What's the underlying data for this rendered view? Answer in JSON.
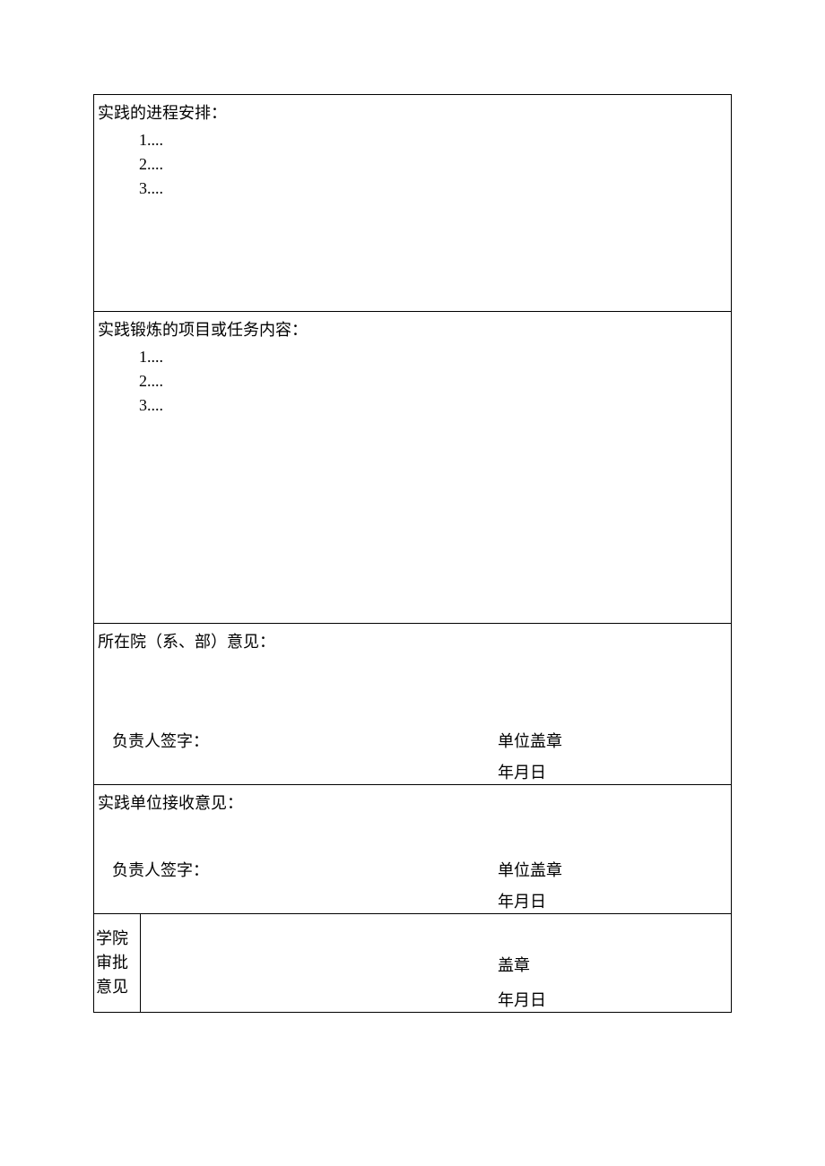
{
  "section1": {
    "title": "实践的进程安排：",
    "items": [
      "1....",
      "2....",
      "3...."
    ]
  },
  "section2": {
    "title": "实践锻炼的项目或任务内容：",
    "items": [
      "1....",
      "2....",
      "3...."
    ]
  },
  "section3": {
    "title": "所在院（系、部）意见：",
    "sign_label": "负责人签字：",
    "stamp_label": "单位盖章",
    "date_label": "年月日"
  },
  "section4": {
    "title": "实践单位接收意见：",
    "sign_label": "负责人签字：",
    "stamp_label": "单位盖章",
    "date_label": "年月日"
  },
  "section5": {
    "side_label": "学院审批意见",
    "stamp_label": "盖章",
    "date_label": "年月日"
  }
}
